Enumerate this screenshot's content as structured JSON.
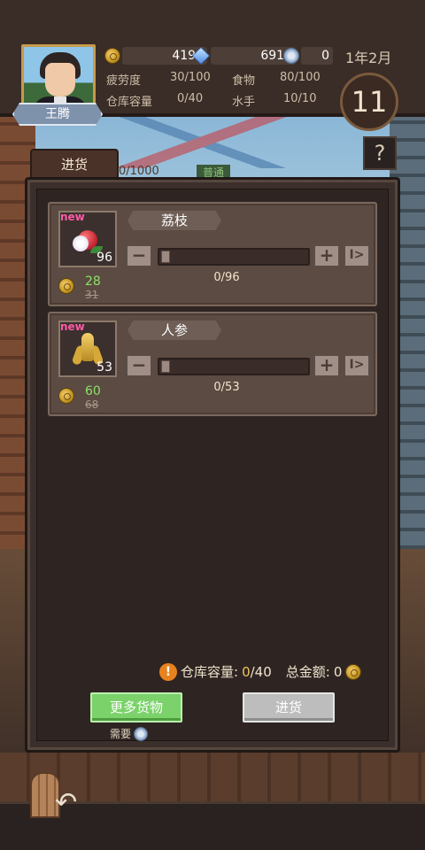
{
  "player": {
    "name": "王腾"
  },
  "resources": {
    "gold": "4191",
    "gems": "6919",
    "badges": "0"
  },
  "stats": {
    "fatigue_label": "疲劳度",
    "fatigue_value": "30/100",
    "food_label": "食物",
    "food_value": "80/100",
    "warehouse_label": "仓库容量",
    "warehouse_value": "0/40",
    "sailor_label": "水手",
    "sailor_value": "10/10"
  },
  "calendar": {
    "date": "1年2月",
    "day": "11"
  },
  "help_label": "?",
  "tab": {
    "label": "进货",
    "capacity_text": "0/1000",
    "quality_badge": "普通"
  },
  "items": [
    {
      "name": "荔枝",
      "tag": "new",
      "stock": "96",
      "price": "28",
      "old_price": "31",
      "quantity": "0/96",
      "icon": "lychee-icon"
    },
    {
      "name": "人参",
      "tag": "new",
      "stock": "53",
      "price": "60",
      "old_price": "68",
      "quantity": "0/53",
      "icon": "ginseng-icon"
    }
  ],
  "controls": {
    "minus": "−",
    "plus": "+",
    "max": "I>"
  },
  "summary": {
    "warn": "!",
    "capacity_label": "仓库容量:",
    "capacity_used": "0",
    "capacity_total": "/40",
    "total_label": "总金额:",
    "total_value": "0"
  },
  "buttons": {
    "more_goods": "更多货物",
    "buy": "进货",
    "need_label": "需要"
  },
  "colors": {
    "accent_green": "#7bd26a",
    "disabled_gray": "#bdbdbd",
    "price_green": "#8ce06c",
    "new_pink": "#ff5aa8",
    "highlight_gold": "#f2c15c"
  }
}
